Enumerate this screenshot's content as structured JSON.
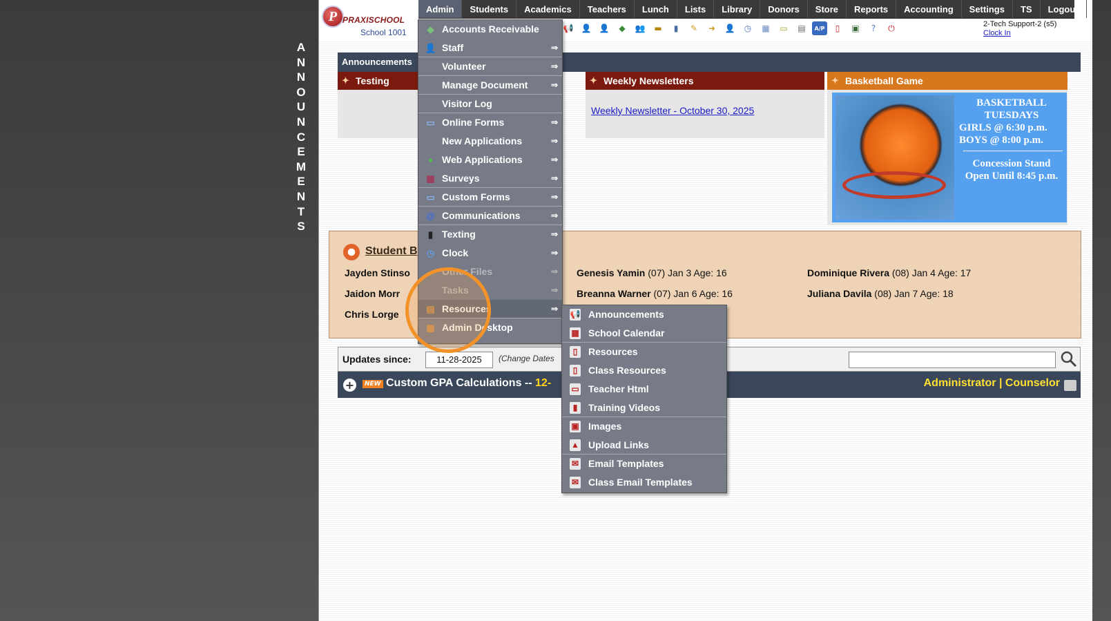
{
  "side_label": [
    "A",
    "N",
    "N",
    "O",
    "U",
    "N",
    "C",
    "E",
    "M",
    "E",
    "N",
    "T",
    "S"
  ],
  "logo": {
    "letter": "P",
    "brand": "PRAXISCHOOL",
    "school": "School 1001"
  },
  "nav": [
    "Admin",
    "Students",
    "Academics",
    "Teachers",
    "Lunch",
    "Lists",
    "Library",
    "Donors",
    "Store",
    "Reports",
    "Accounting",
    "Settings",
    "TS",
    "Logout"
  ],
  "support": {
    "user": "2-Tech Support-2 (s5)",
    "clock": "Clock In"
  },
  "announcements_header": "Announcements",
  "panels": {
    "testing": "Testing",
    "newsletters": "Weekly Newsletters",
    "newsletter_link": "Weekly Newsletter - October 30, 2025",
    "game": "Basketball Game"
  },
  "basketball": {
    "l1": "BASKETBALL",
    "l2": "TUESDAYS",
    "l3": "GIRLS @ 6:30 p.m.",
    "l4": "BOYS  @ 8:00 p.m.",
    "l5": "Concession Stand",
    "l6": "Open Until 8:45 p.m."
  },
  "birthdays": {
    "title": "Student B",
    "col1": [
      {
        "name": "Jayden Stinso"
      },
      {
        "name": "Jaidon Morr"
      },
      {
        "name": "Chris Lorge"
      }
    ],
    "col2": [
      {
        "name": "Genesis Yamin",
        "info": " (07) Jan 3 Age: 16"
      },
      {
        "name": "Breanna Warner",
        "info": " (07) Jan 6 Age: 16"
      }
    ],
    "col3": [
      {
        "name": "Dominique Rivera",
        "info": " (08) Jan 4 Age: 17"
      },
      {
        "name": "Juliana Davila",
        "info": " (08) Jan 7 Age: 18"
      }
    ]
  },
  "updates": {
    "label": "Updates since:",
    "date": "11-28-2025",
    "change": "(Change Dates"
  },
  "gpa": {
    "new": "NEW",
    "title": "Custom GPA Calculations -- ",
    "suffix": "12-",
    "roles": "Administrator | Counselor"
  },
  "admin_menu": [
    {
      "label": "Accounts Receivable",
      "icon": "money-icon",
      "arrow": ""
    },
    {
      "label": "Staff",
      "icon": "staff-icon",
      "arrow": "⇒"
    },
    {
      "label": "Volunteer",
      "icon": "",
      "arrow": "⇒"
    },
    {
      "label": "Manage Document",
      "icon": "",
      "arrow": "⇒"
    },
    {
      "label": "Visitor Log",
      "icon": "",
      "arrow": ""
    },
    {
      "label": "Online Forms",
      "icon": "html-icon",
      "arrow": "⇒"
    },
    {
      "label": "New Applications",
      "icon": "",
      "arrow": "⇒"
    },
    {
      "label": "Web Applications",
      "icon": "globe-icon",
      "arrow": "⇒"
    },
    {
      "label": "Surveys",
      "icon": "survey-icon",
      "arrow": "⇒"
    },
    {
      "label": "Custom Forms",
      "icon": "html-icon",
      "arrow": "⇒"
    },
    {
      "label": "Communications",
      "icon": "at-icon",
      "arrow": "⇒"
    },
    {
      "label": "Texting",
      "icon": "phone-icon",
      "arrow": "⇒"
    },
    {
      "label": "Clock",
      "icon": "clock-icon",
      "arrow": "⇒"
    },
    {
      "label": "Other Files",
      "icon": "",
      "arrow": "⇒"
    },
    {
      "label": "Tasks",
      "icon": "",
      "arrow": "⇒"
    },
    {
      "label": "Resources",
      "icon": "resources-icon",
      "arrow": "⇒"
    },
    {
      "label": "Admin Desktop",
      "icon": "desktop-icon",
      "arrow": ""
    }
  ],
  "resources_submenu": [
    {
      "label": "Announcements",
      "icon": "megaphone-icon"
    },
    {
      "label": "School Calendar",
      "icon": "calendar-icon"
    },
    {
      "label": "Resources",
      "icon": "pdf-icon"
    },
    {
      "label": "Class Resources",
      "icon": "pdf-icon"
    },
    {
      "label": "Teacher Html",
      "icon": "html-icon"
    },
    {
      "label": "Training Videos",
      "icon": "film-icon"
    },
    {
      "label": "Images",
      "icon": "image-icon"
    },
    {
      "label": "Upload Links",
      "icon": "upload-icon"
    },
    {
      "label": "Email Templates",
      "icon": "mail-icon"
    },
    {
      "label": "Class Email Templates",
      "icon": "mail-icon"
    }
  ],
  "colors": {
    "nav_bg": "#3a3a3a",
    "menu_bg": "#767b87",
    "highlight": "#f4922a",
    "announce_bar": "#3a4659",
    "panel_red": "#7a1a0e",
    "panel_orange": "#d7781e"
  }
}
